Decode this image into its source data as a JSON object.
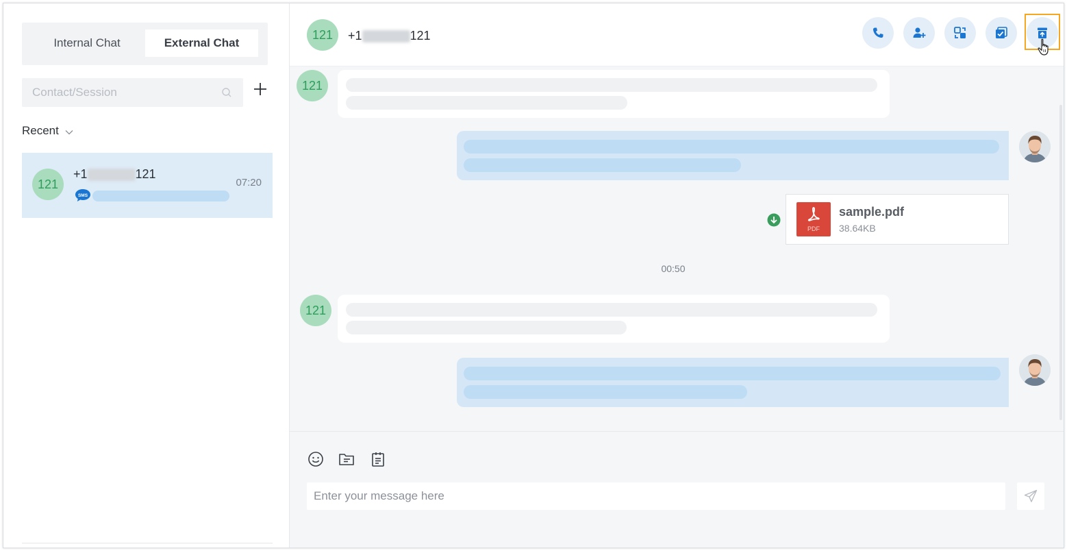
{
  "sidebar": {
    "tabs": [
      {
        "label": "Internal Chat",
        "active": false
      },
      {
        "label": "External Chat",
        "active": true
      }
    ],
    "search": {
      "placeholder": "Contact/Session"
    },
    "filter": {
      "label": "Recent"
    },
    "conversations": [
      {
        "avatar_text": "121",
        "name_prefix": "+1",
        "name_suffix": "121",
        "time": "07:20",
        "channel_icon": "sms-icon",
        "channel_label": "SMS"
      }
    ]
  },
  "chat": {
    "header": {
      "avatar_text": "121",
      "name_prefix": "+1",
      "name_suffix": "121",
      "actions": [
        "phone-icon",
        "add-contact-icon",
        "transfer-icon",
        "end-session-icon",
        "archive-icon"
      ]
    },
    "messages": [
      {
        "direction": "incoming",
        "avatar_text": "121"
      },
      {
        "direction": "outgoing"
      },
      {
        "direction": "outgoing",
        "type": "file",
        "file_name": "sample.pdf",
        "file_size": "38.64KB",
        "file_type_label": "PDF"
      },
      {
        "type": "timestamp",
        "text": "00:50"
      },
      {
        "direction": "incoming",
        "avatar_text": "121"
      },
      {
        "direction": "outgoing"
      }
    ],
    "composer": {
      "placeholder": "Enter your message here",
      "tools": [
        "emoji-icon",
        "file-icon",
        "template-icon"
      ]
    }
  },
  "colors": {
    "accent": "#1b76d2",
    "avatar_bg": "#a8dcbc",
    "avatar_text": "#2d9d5c",
    "active_conversation": "#deecf8",
    "highlight_border": "#f5a623",
    "pdf_red": "#d9473a",
    "download_green": "#3a9d5d"
  }
}
